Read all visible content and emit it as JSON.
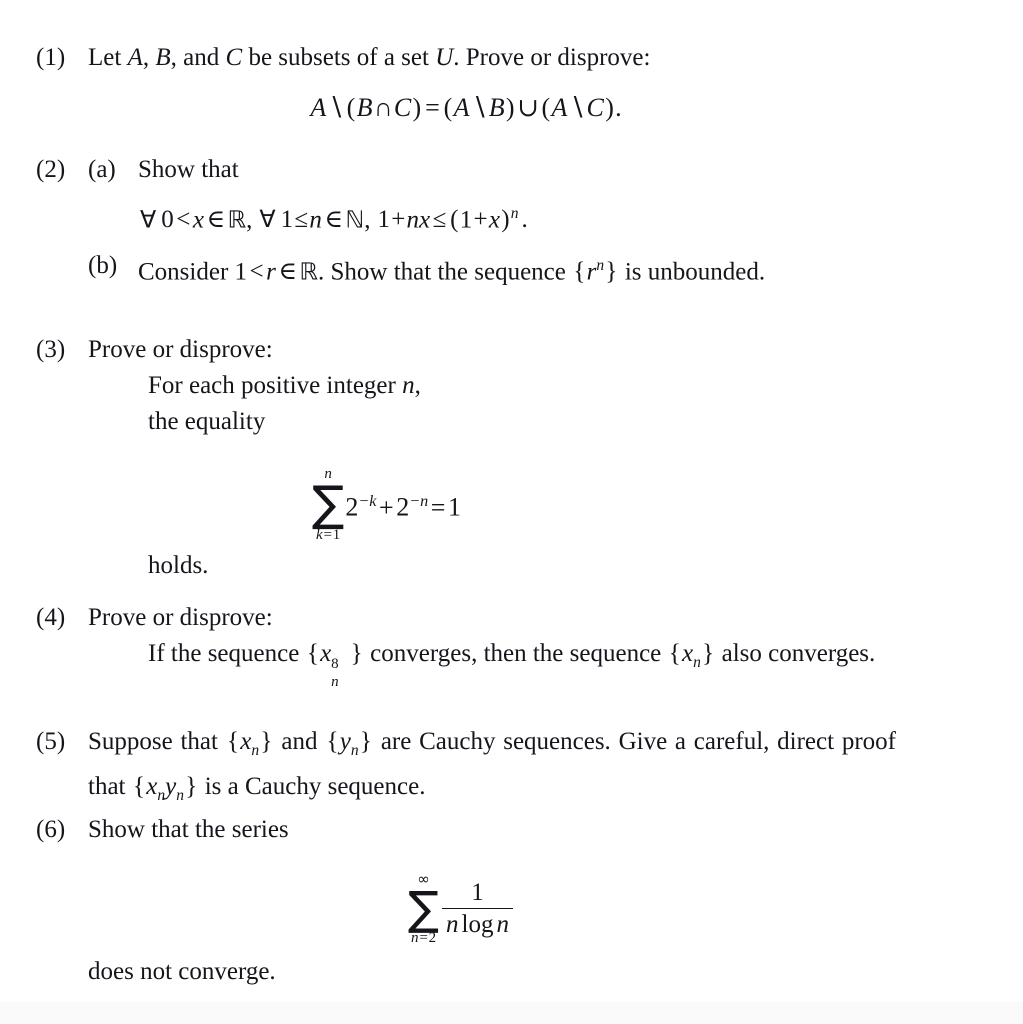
{
  "document": {
    "type": "math-problem-set",
    "background_color": "#ffffff",
    "text_color": "#15151c",
    "bottom_band_color": "#fafafa"
  },
  "problems": [
    {
      "label": "(1)",
      "text_before": "Let ",
      "var_a": "A",
      "comma1": ", ",
      "var_b": "B",
      "comma2": ", and ",
      "var_c": "C",
      "text_mid": " be subsets of a set ",
      "var_u": "U",
      "text_after": ". Prove or disprove:",
      "equation": {
        "lhs_a": "A",
        "setminus": "∖",
        "open1": "(",
        "b": "B",
        "cap": "∩",
        "c": "C",
        "close1": ")",
        "equals": "=",
        "open2": "(",
        "a2": "A",
        "setminus2": "∖",
        "b2": "B",
        "close2": ")",
        "cup": "∪",
        "open3": "(",
        "a3": "A",
        "setminus3": "∖",
        "c3": "C",
        "close3": ")",
        "period": "."
      }
    },
    {
      "label": "(2)",
      "parts": [
        {
          "sublabel": "(a)",
          "text": "Show that",
          "equation": {
            "forall1": "∀",
            "zero": "0",
            "lt": "<",
            "x": "x",
            "in1": "∈",
            "reals": "ℝ",
            "comma1": ",",
            "forall2": "∀",
            "one": "1",
            "le1": "≤",
            "n": "n",
            "in2": "∈",
            "naturals": "ℕ",
            "comma2": ",",
            "one2": "1",
            "plus": "+",
            "nx": "nx",
            "le2": "≤",
            "open": "(",
            "one3": "1",
            "plus2": "+",
            "x2": "x",
            "close": ")",
            "exp_n": "n",
            "period": "."
          }
        },
        {
          "sublabel": "(b)",
          "text_1": "Consider ",
          "one": "1",
          "lt": "<",
          "r": "r",
          "in": "∈",
          "reals": "ℝ",
          "text_2": ". Show that the sequence ",
          "seq_open": "{",
          "seq_r": "r",
          "seq_exp": "n",
          "seq_close": "}",
          "text_3": " is unbounded."
        }
      ]
    },
    {
      "label": "(3)",
      "text": "Prove or disprove:",
      "line1_a": "For each positive integer ",
      "line1_n": "n",
      "line1_b": ",",
      "line2": "the equality",
      "equation": {
        "upper_limit": "n",
        "sigma": "∑",
        "lower_limit_k": "k",
        "lower_limit_eq": "=",
        "lower_limit_1": "1",
        "term1_base": "2",
        "term1_exp": "−k",
        "plus": "+",
        "term2_base": "2",
        "term2_exp": "−n",
        "equals": "=",
        "rhs": "1"
      },
      "closing": "holds."
    },
    {
      "label": "(4)",
      "text": "Prove or disprove:",
      "body_1": "If the sequence ",
      "seq1_open": "{",
      "seq1_x": "x",
      "seq1_sup": "8",
      "seq1_sub": "n",
      "seq1_close": "}",
      "body_2": " converges, then the sequence ",
      "seq2_open": "{",
      "seq2_x": "x",
      "seq2_sub": "n",
      "seq2_close": "}",
      "body_3": " also converges."
    },
    {
      "label": "(5)",
      "text_1": "Suppose that ",
      "seq1_open": "{",
      "seq1_x": "x",
      "seq1_sub": "n",
      "seq1_close": "}",
      "text_2": " and ",
      "seq2_open": "{",
      "seq2_y": "y",
      "seq2_sub": "n",
      "seq2_close": "}",
      "text_3": " are Cauchy sequences.  Give a careful, direct proof that ",
      "seq3_open": "{",
      "seq3_x": "x",
      "seq3_xsub": "n",
      "seq3_y": "y",
      "seq3_ysub": "n",
      "seq3_close": "}",
      "text_4": " is a Cauchy sequence."
    },
    {
      "label": "(6)",
      "text": "Show that the series",
      "equation": {
        "upper_limit": "∞",
        "sigma": "∑",
        "lower_limit_n": "n",
        "lower_limit_eq": "=",
        "lower_limit_2": "2",
        "numerator": "1",
        "den_n1": "n",
        "den_log": "log",
        "den_n2": "n"
      },
      "closing": "does not converge."
    }
  ]
}
